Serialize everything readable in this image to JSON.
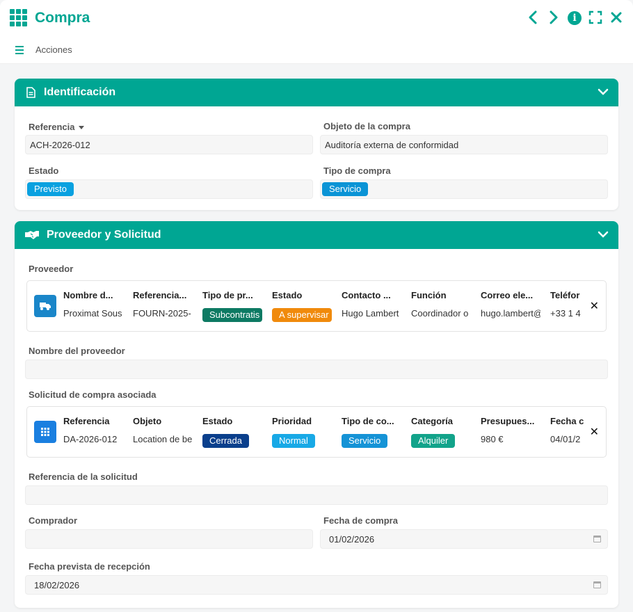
{
  "header": {
    "title": "Compra"
  },
  "actions": {
    "label": "Acciones"
  },
  "identificacion": {
    "title": "Identificación",
    "referencia": {
      "label": "Referencia",
      "value": "ACH-2026-012"
    },
    "objeto": {
      "label": "Objeto de la compra",
      "value": "Auditoría externa de conformidad"
    },
    "estado": {
      "label": "Estado",
      "value": "Previsto",
      "color": "#0aa1e0"
    },
    "tipo": {
      "label": "Tipo de compra",
      "value": "Servicio",
      "color": "#0b94d6"
    }
  },
  "proveedor": {
    "title": "Proveedor y Solicitud",
    "proveedor_label": "Proveedor",
    "columns": [
      {
        "header": "Nombre d...",
        "value": "Proximat Sous"
      },
      {
        "header": "Referencia...",
        "value": "FOURN-2025-"
      },
      {
        "header": "Tipo de pr...",
        "badge": "Subcontratis",
        "color": "#0d7a63"
      },
      {
        "header": "Estado",
        "badge": "A supervisar",
        "color": "#f08a0c"
      },
      {
        "header": "Contacto ...",
        "value": "Hugo Lambert"
      },
      {
        "header": "Función",
        "value": "Coordinador o"
      },
      {
        "header": "Correo ele...",
        "value": "hugo.lambert@"
      },
      {
        "header": "Teléfor",
        "value": "+33 1 4"
      }
    ],
    "nombre_label": "Nombre del proveedor",
    "solicitud_label": "Solicitud de compra asociada",
    "solicitud_columns": [
      {
        "header": "Referencia",
        "value": "DA-2026-012"
      },
      {
        "header": "Objeto",
        "value": "Location de be"
      },
      {
        "header": "Estado",
        "badge": "Cerrada",
        "color": "#0a3f8c"
      },
      {
        "header": "Prioridad",
        "badge": "Normal",
        "color": "#18a9e6"
      },
      {
        "header": "Tipo de co...",
        "badge": "Servicio",
        "color": "#1593d6"
      },
      {
        "header": "Categoría",
        "badge": "Alquiler",
        "color": "#12a38a"
      },
      {
        "header": "Presupues...",
        "value": "980 €"
      },
      {
        "header": "Fecha c",
        "value": "04/01/2"
      }
    ],
    "ref_solicitud_label": "Referencia de la solicitud",
    "comprador_label": "Comprador",
    "fecha_compra": {
      "label": "Fecha de compra",
      "value": "01/02/2026"
    },
    "fecha_recepcion": {
      "label": "Fecha prevista de recepción",
      "value": "18/02/2026"
    }
  },
  "colors": {
    "accent": "#00a693"
  }
}
